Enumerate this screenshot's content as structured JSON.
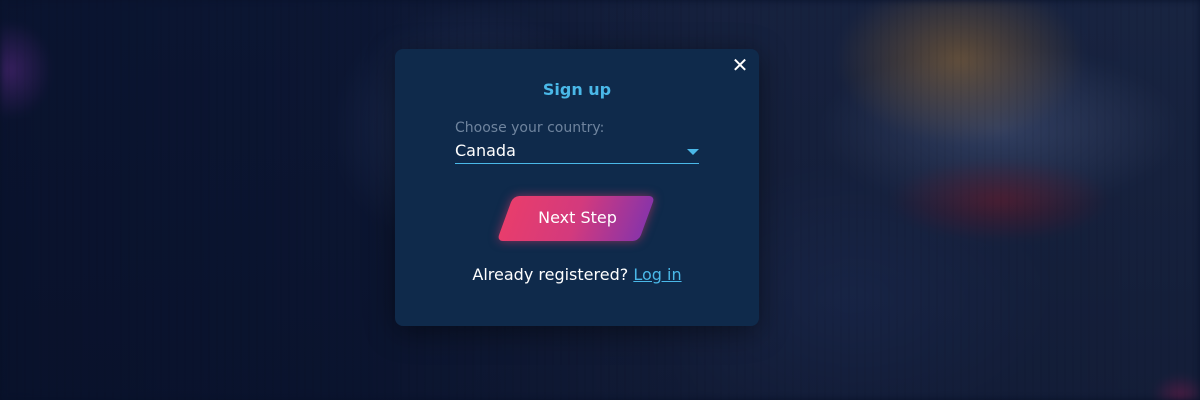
{
  "modal": {
    "title": "Sign up",
    "close_icon": "close-icon",
    "country_label": "Choose your country:",
    "country_value": "Canada",
    "dropdown_icon": "caret-down-icon",
    "next_button_label": "Next Step",
    "already_registered_text": "Already registered?",
    "login_link_text": "Log in"
  },
  "colors": {
    "modal_background": "#0f2a4b",
    "accent": "#4ab8e8",
    "button_gradient_start": "#e83d6c",
    "button_gradient_end": "#8a34a8"
  }
}
